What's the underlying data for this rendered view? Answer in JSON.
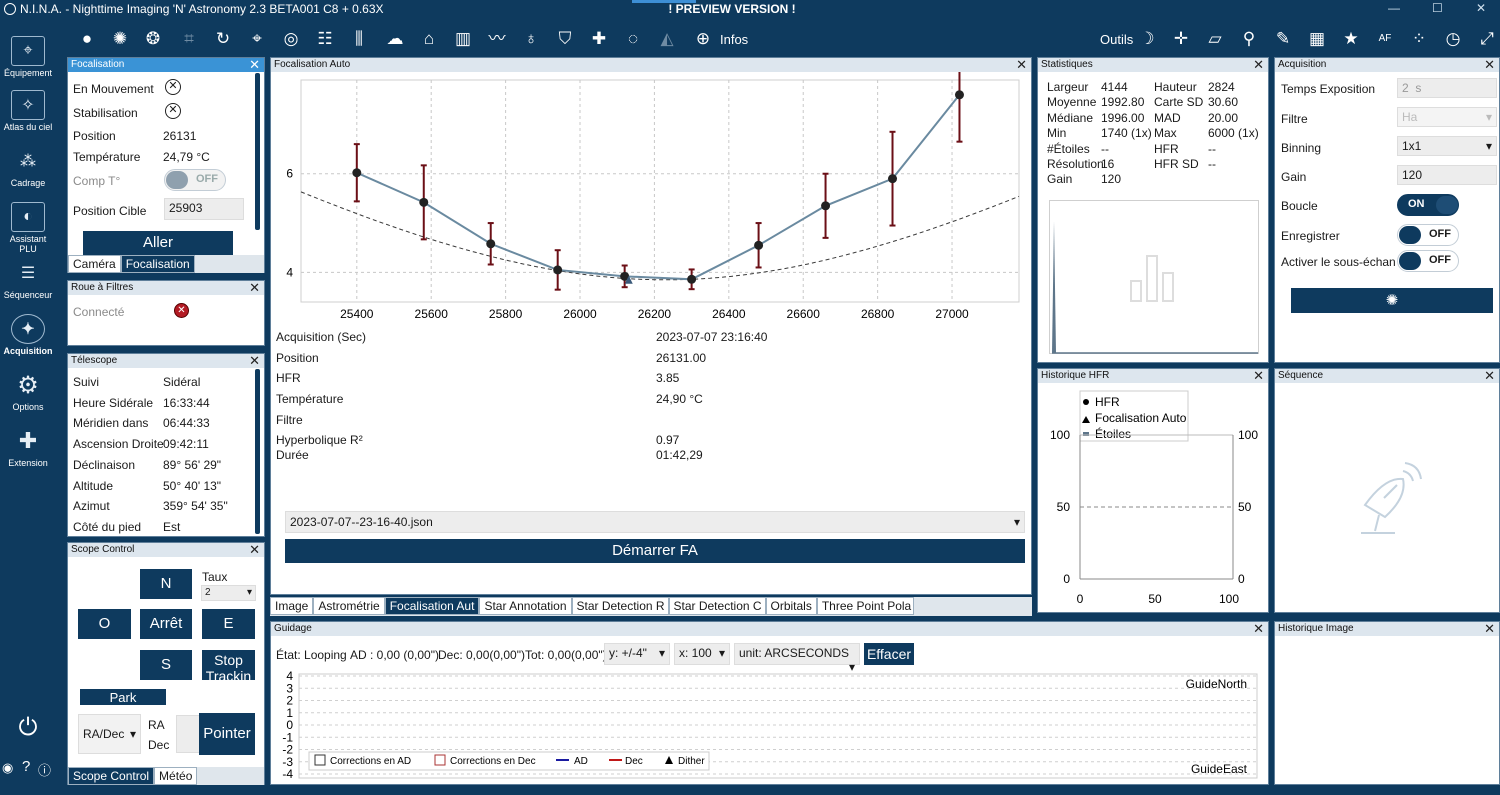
{
  "window": {
    "title": "N.I.N.A. - Nighttime Imaging 'N' Astronomy 2.3 BETA001    C8 + 0.63X",
    "preview": "! PREVIEW VERSION !"
  },
  "sidebar": {
    "items": [
      {
        "label": "Équipement"
      },
      {
        "label": "Atlas du ciel"
      },
      {
        "label": "Cadrage"
      },
      {
        "label": "Assistant PLU"
      },
      {
        "label": "Séquenceur"
      },
      {
        "label": "Acquisition"
      },
      {
        "label": "Options"
      },
      {
        "label": "Extension"
      }
    ],
    "bottom_help": "?"
  },
  "toolbar": {
    "infos_label": "Infos",
    "outils_label": "Outils"
  },
  "focuser": {
    "title": "Focalisation",
    "moving_label": "En Mouvement",
    "settle_label": "Stabilisation",
    "position_label": "Position",
    "position_value": "26131",
    "temp_label": "Température",
    "temp_value": "24,79 °C",
    "comp_label": "Comp T°",
    "comp_state": "OFF",
    "target_label": "Position Cible",
    "target_value": "25903",
    "go_label": "Aller",
    "tabs": [
      "Caméra",
      "Focalisation"
    ]
  },
  "filterwheel": {
    "title": "Roue à Filtres",
    "connected_label": "Connecté"
  },
  "telescope": {
    "title": "Télescope",
    "rows": [
      {
        "k": "Suivi",
        "v": "Sidéral"
      },
      {
        "k": "Heure Sidérale",
        "v": "16:33:44"
      },
      {
        "k": "Méridien dans",
        "v": "06:44:33"
      },
      {
        "k": "Ascension Droite",
        "v": "09:42:11"
      },
      {
        "k": "Déclinaison",
        "v": "89° 56' 29\""
      },
      {
        "k": "Altitude",
        "v": "50° 40' 13\""
      },
      {
        "k": "Azimut",
        "v": "359° 54' 35\""
      },
      {
        "k": "Côté du pied",
        "v": "Est"
      }
    ]
  },
  "scopecontrol": {
    "title": "Scope Control",
    "rate_label": "Taux",
    "rate_value": "2",
    "n": "N",
    "o": "O",
    "stop": "Arrêt",
    "e": "E",
    "s": "S",
    "stop_tracking": "Stop Trackin",
    "park": "Park",
    "coord_select": "RA/Dec",
    "ra": "RA",
    "dec": "Dec",
    "point": "Pointer",
    "tabs": [
      "Scope Control",
      "Météo"
    ]
  },
  "autofocus": {
    "title": "Focalisation Auto",
    "rows": [
      {
        "k": "Acquisition (Sec)",
        "v": "2023-07-07 23:16:40"
      },
      {
        "k": "Position",
        "v": "26131.00"
      },
      {
        "k": "HFR",
        "v": "3.85"
      },
      {
        "k": "Température",
        "v": "24,90 °C"
      },
      {
        "k": "Filtre",
        "v": ""
      },
      {
        "k": "Hyperbolique R²",
        "v": "0.97"
      },
      {
        "k": "Durée",
        "v": "01:42,29"
      }
    ],
    "file": "2023-07-07--23-16-40.json",
    "start_label": "Démarrer FA"
  },
  "center_tabs": [
    "Image",
    "Astrométrie",
    "Focalisation Aut",
    "Star Annotation",
    "Star Detection R",
    "Star Detection C",
    "Orbitals",
    "Three Point Pola"
  ],
  "stats": {
    "title": "Statistiques",
    "left": [
      {
        "k": "Largeur",
        "v": "4144"
      },
      {
        "k": "Moyenne",
        "v": "1992.80"
      },
      {
        "k": "Médiane",
        "v": "1996.00"
      },
      {
        "k": "Min",
        "v": "1740 (1x)"
      },
      {
        "k": "#Étoiles",
        "v": "--"
      },
      {
        "k": "Résolution",
        "v": "16"
      },
      {
        "k": "Gain",
        "v": "120"
      }
    ],
    "right": [
      {
        "k": "Hauteur",
        "v": "2824"
      },
      {
        "k": "Carte SD",
        "v": "30.60"
      },
      {
        "k": "MAD",
        "v": "20.00"
      },
      {
        "k": "Max",
        "v": "6000 (1x)"
      },
      {
        "k": "HFR",
        "v": "--"
      },
      {
        "k": "HFR SD",
        "v": "--"
      }
    ]
  },
  "acquisition": {
    "title": "Acquisition",
    "exposure_label": "Temps Exposition",
    "exposure_value": "2",
    "exposure_unit": "s",
    "filter_label": "Filtre",
    "filter_value": "Ha",
    "binning_label": "Binning",
    "binning_value": "1x1",
    "gain_label": "Gain",
    "gain_value": "120",
    "loop_label": "Boucle",
    "loop_state": "ON",
    "save_label": "Enregistrer",
    "save_state": "OFF",
    "sub_label": "Activer le sous-échan",
    "sub_state": "OFF"
  },
  "hfrhistory": {
    "title": "Historique HFR",
    "legend": [
      "HFR",
      "Focalisation Auto",
      "Étoiles"
    ],
    "yticks": [
      "100",
      "50",
      "0"
    ],
    "xticks": [
      "0",
      "50",
      "100"
    ]
  },
  "sequence": {
    "title": "Séquence"
  },
  "imagehistory": {
    "title": "Historique Image"
  },
  "guiding": {
    "title": "Guidage",
    "state": "État: Looping",
    "ad": "AD : 0,00 (0,00\")",
    "dec": "Dec: 0,00(0,00\")",
    "tot": "Tot: 0,00(0,00\")",
    "y_select": "y: +/-4\"",
    "x_select": "x: 100",
    "unit_select": "unit: ARCSECONDS",
    "clear_label": "Effacer",
    "north": "GuideNorth",
    "east": "GuideEast",
    "yticks": [
      "4",
      "3",
      "2",
      "1",
      "0",
      "-1",
      "-2",
      "-3",
      "-4"
    ],
    "legend": [
      "Corrections en AD",
      "Corrections en Dec",
      "AD",
      "Dec",
      "Dither"
    ]
  },
  "colors": {
    "navy": "#0e3a5e",
    "accent": "#3a93d6",
    "error": "#6b0f16"
  },
  "chart_data": {
    "type": "line",
    "title": "",
    "xlabel": "",
    "ylabel": "",
    "xlim": [
      25250,
      27180
    ],
    "ylim": [
      3.4,
      7.9
    ],
    "xticks": [
      25400,
      25600,
      25800,
      26000,
      26200,
      26400,
      26600,
      26800,
      27000
    ],
    "yticks": [
      4,
      6
    ],
    "x": [
      25400,
      25580,
      25760,
      25940,
      26120,
      26300,
      26480,
      26660,
      26840,
      27020
    ],
    "y": [
      6.02,
      5.42,
      4.58,
      4.05,
      3.92,
      3.86,
      4.55,
      5.35,
      5.9,
      7.6
    ],
    "err": [
      0.58,
      0.75,
      0.42,
      0.4,
      0.22,
      0.2,
      0.45,
      0.65,
      0.95,
      0.95
    ],
    "series": [
      {
        "name": "HFR",
        "values": [
          6.02,
          5.42,
          4.58,
          4.05,
          3.92,
          3.86,
          4.55,
          5.35,
          5.9,
          7.6
        ]
      }
    ],
    "fit": "hyperbolic",
    "grid": true
  }
}
